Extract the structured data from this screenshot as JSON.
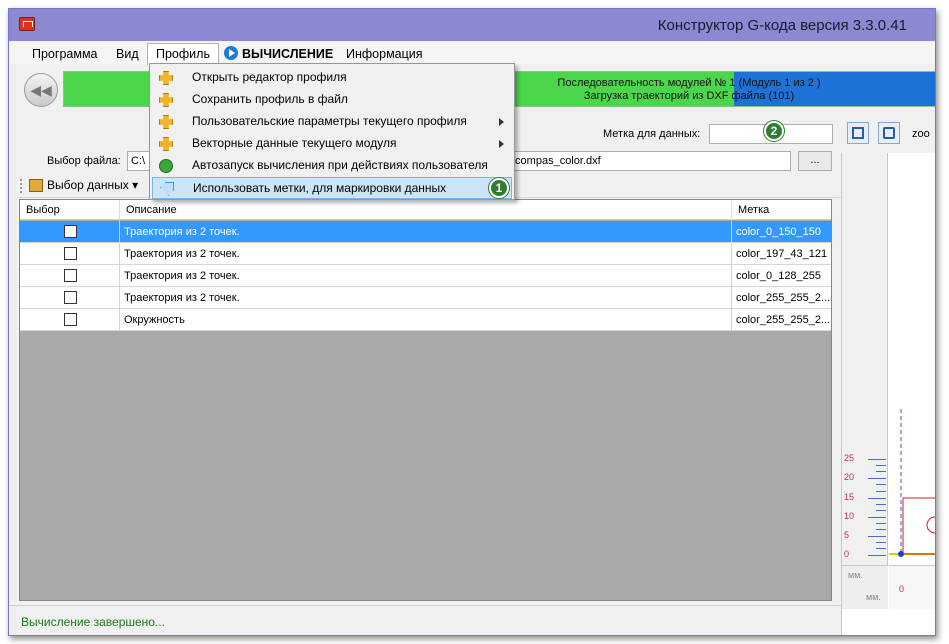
{
  "window": {
    "title": "Конструктор G-кода версия 3.3.0.41"
  },
  "menu": {
    "items": [
      "Программа",
      "Вид",
      "Профиль",
      "ВЫЧИСЛЕНИЕ",
      "Информация"
    ]
  },
  "progress": {
    "line1": "Последовательность модулей № 1 (Модуль 1 из 2 )",
    "line2": "Загрузка траекторий из DXF файла (101)",
    "color_done": "#4cd64c",
    "color_active": "#1e72d6"
  },
  "label_field": {
    "label": "Метка для данных:",
    "value": ""
  },
  "zoom_label": "zoo",
  "file": {
    "label": "Выбор файла:",
    "value_left": "C:\\",
    "value_right": "\\compas_color.dxf",
    "browse_label": "..."
  },
  "toolstrip": {
    "data_select_label": "Выбор данных"
  },
  "table": {
    "columns": [
      "Выбор",
      "Описание",
      "Метка"
    ],
    "rows": [
      {
        "description": "Траектория из 2 точек.",
        "tag": "color_0_150_150",
        "selected": true
      },
      {
        "description": "Траектория из 2 точек.",
        "tag": "color_197_43_121",
        "selected": false
      },
      {
        "description": "Траектория из 2 точек.",
        "tag": "color_0_128_255",
        "selected": false
      },
      {
        "description": "Траектория из 2 точек.",
        "tag": "color_255_255_2...",
        "selected": false
      },
      {
        "description": "Окружность",
        "tag": "color_255_255_2...",
        "selected": false
      }
    ]
  },
  "profile_menu": {
    "items": [
      {
        "label": "Открыть редактор профиля",
        "icon": "puzzle-icon"
      },
      {
        "label": "Сохранить профиль в файл",
        "icon": "puzzle-save-icon"
      },
      {
        "label": "Пользовательские параметры текущего профиля",
        "icon": "puzzle-icon",
        "submenu": true
      },
      {
        "label": "Векторные данные текущего модуля",
        "icon": "puzzle-icon",
        "submenu": true
      },
      {
        "label": "Автозапуск вычисления при действиях пользователя",
        "icon": "autorun-icon"
      },
      {
        "label": "Использовать метки, для маркировки данных",
        "icon": "tag-icon"
      }
    ]
  },
  "badges": {
    "one": "1",
    "two": "2"
  },
  "ruler": {
    "labels": [
      "25",
      "20",
      "15",
      "10",
      "5",
      "0"
    ],
    "unit": "мм.",
    "bottom_zero": "0"
  },
  "status": {
    "text": "Вычисление завершено..."
  }
}
